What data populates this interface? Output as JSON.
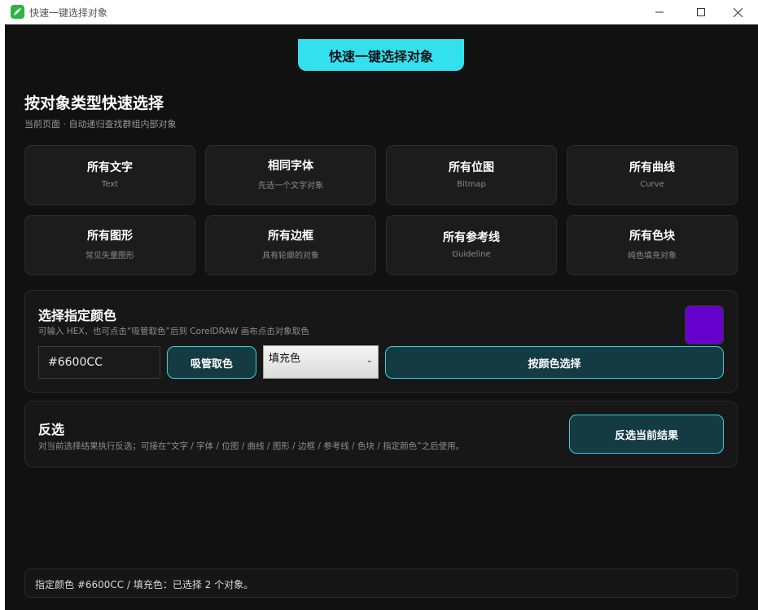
{
  "window": {
    "title": "快速一键选择对象"
  },
  "header": {
    "label": "快速一键选择对象"
  },
  "type_section": {
    "title": "按对象类型快速选择",
    "subtitle": "当前页面 · 自动递归查找群组内部对象",
    "cards": [
      {
        "title": "所有文字",
        "subtitle": "Text"
      },
      {
        "title": "相同字体",
        "subtitle": "先选一个文字对象"
      },
      {
        "title": "所有位图",
        "subtitle": "Bitmap"
      },
      {
        "title": "所有曲线",
        "subtitle": "Curve"
      },
      {
        "title": "所有图形",
        "subtitle": "常见矢量图形"
      },
      {
        "title": "所有边框",
        "subtitle": "具有轮廓的对象"
      },
      {
        "title": "所有参考线",
        "subtitle": "Guideline"
      },
      {
        "title": "所有色块",
        "subtitle": "纯色填充对象"
      }
    ]
  },
  "color_section": {
    "title": "选择指定颜色",
    "subtitle": "可输入 HEX，也可点击“吸管取色”后到 CorelDRAW 画布点击对象取色",
    "swatch_color": "#6600CC",
    "hex_value": "#6600CC",
    "pick_label": "吸管取色",
    "mode_selected": "填充色",
    "select_label": "按颜色选择"
  },
  "invert_section": {
    "title": "反选",
    "subtitle": "对当前选择结果执行反选；可接在“文字 / 字体 / 位图 / 曲线 / 图形 / 边框 / 参考线 / 色块 / 指定颜色”之后使用。",
    "button_label": "反选当前结果"
  },
  "status": {
    "text": "指定颜色 #6600CC / 填充色：已选择 2 个对象。"
  },
  "colors": {
    "accent": "#33E1EE",
    "background": "#111111",
    "card": "#1C1C1C",
    "teal_button": "#143A42"
  }
}
